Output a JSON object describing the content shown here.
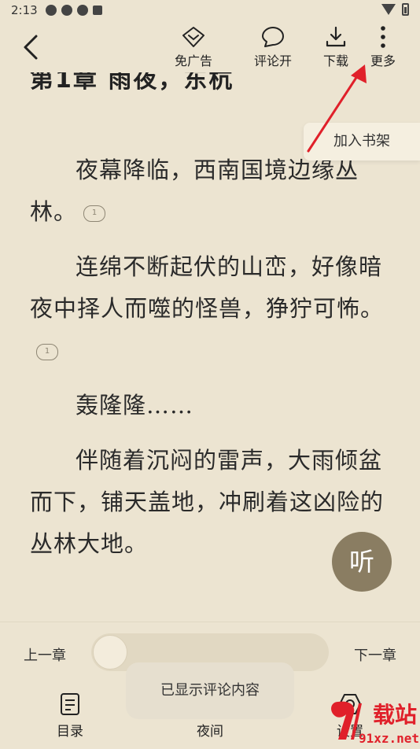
{
  "status_bar": {
    "time": "2:13"
  },
  "toolbar": {
    "buttons": [
      {
        "label": "免广告",
        "icon": "diamond-icon"
      },
      {
        "label": "评论开",
        "icon": "comment-icon"
      },
      {
        "label": "下载",
        "icon": "download-icon"
      },
      {
        "label": "更多",
        "icon": "more-icon"
      }
    ]
  },
  "popup": {
    "add_shelf": "加入书架"
  },
  "chapter": {
    "title": "第1章 雨夜，东杭",
    "paragraphs": [
      {
        "text": "夜幕降临，西南国境边缘丛林。",
        "comments": "1"
      },
      {
        "text": "连绵不断起伏的山峦，好像暗夜中择人而噬的怪兽，狰狞可怖。",
        "comments": "1"
      },
      {
        "text": "轰隆隆……"
      },
      {
        "text": "伴随着沉闷的雷声，大雨倾盆而下，铺天盖地，冲刷着这凶险的丛林大地。"
      }
    ]
  },
  "listen": {
    "label": "听"
  },
  "bottom": {
    "prev": "上一章",
    "next": "下一章",
    "progress": 0.0,
    "nav": [
      {
        "label": "目录",
        "icon": "catalog-icon"
      },
      {
        "label": "夜间",
        "icon": "night-icon"
      },
      {
        "label": "设置",
        "icon": "settings-icon"
      }
    ]
  },
  "toast": {
    "text": "已显示评论内容"
  },
  "watermark": {
    "text": "载站",
    "url": "91xz.net"
  },
  "colors": {
    "background": "#ece4d1",
    "arrow": "#e0202a",
    "listen_button": "#8a7d62"
  }
}
